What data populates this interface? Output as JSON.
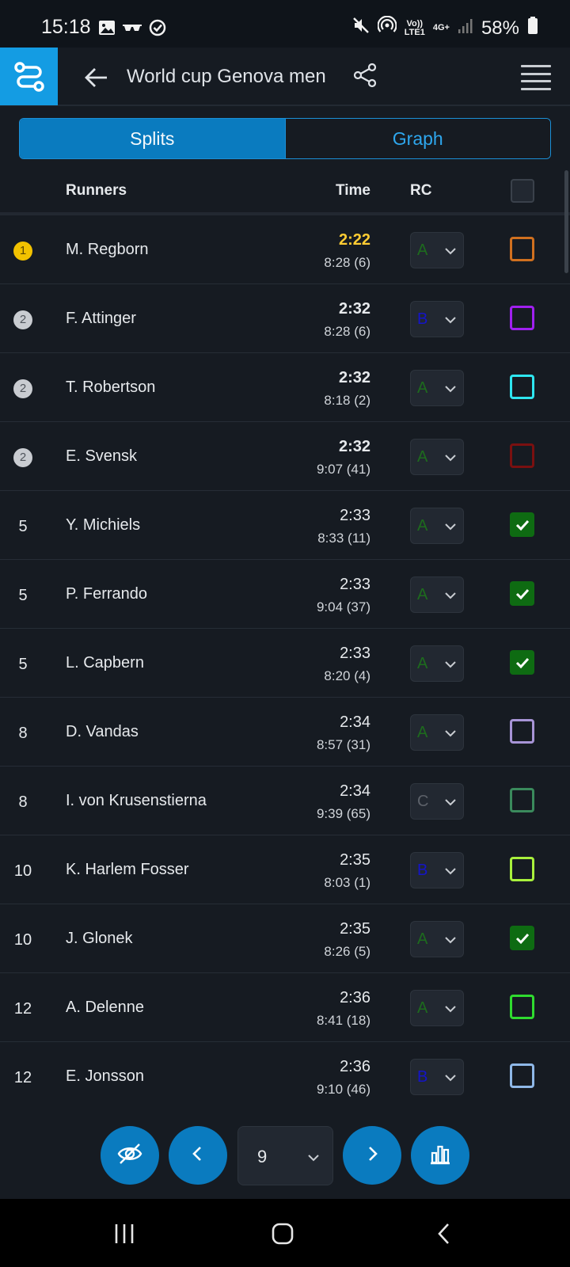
{
  "status_bar": {
    "time": "15:18",
    "battery": "58%",
    "net_top": "Vo))",
    "net_bottom": "LTE1",
    "net_type": "4G+",
    "icons": [
      "image-icon",
      "glasses-icon",
      "check-circle-icon",
      "mute-icon",
      "hotspot-icon",
      "signal-icon",
      "battery-icon"
    ]
  },
  "app_bar": {
    "title": "World cup Genova men",
    "icons": [
      "route-logo-icon",
      "back-arrow-icon",
      "share-icon",
      "menu-icon"
    ],
    "logo_color": "#149ce3"
  },
  "tabs": [
    {
      "label": "Splits",
      "active": true
    },
    {
      "label": "Graph",
      "active": false
    }
  ],
  "list_header": {
    "runners": "Runners",
    "time": "Time",
    "rc": "RC"
  },
  "rows": [
    {
      "rank": "1",
      "medal": "gold",
      "name": "M. Regborn",
      "split": "2:22",
      "split_style": "best",
      "cumulative": "8:28 (6)",
      "rc": "A",
      "rc_color": "#1d6b1d",
      "checkbox": {
        "checked": false,
        "color": "#d0701f"
      }
    },
    {
      "rank": "2",
      "medal": "silver",
      "name": "F. Attinger",
      "split": "2:32",
      "split_style": "bold",
      "cumulative": "8:28 (6)",
      "rc": "B",
      "rc_color": "#1414c8",
      "checkbox": {
        "checked": false,
        "color": "#a020f0"
      }
    },
    {
      "rank": "2",
      "medal": "silver",
      "name": "T. Robertson",
      "split": "2:32",
      "split_style": "bold",
      "cumulative": "8:18 (2)",
      "rc": "A",
      "rc_color": "#1d6b1d",
      "checkbox": {
        "checked": false,
        "color": "#2ee6f0"
      }
    },
    {
      "rank": "2",
      "medal": "silver",
      "name": "E. Svensk",
      "split": "2:32",
      "split_style": "bold",
      "cumulative": "9:07 (41)",
      "rc": "A",
      "rc_color": "#1d6b1d",
      "checkbox": {
        "checked": false,
        "color": "#7a1010"
      }
    },
    {
      "rank": "5",
      "medal": "",
      "name": "Y. Michiels",
      "split": "2:33",
      "split_style": "normal",
      "cumulative": "8:33 (11)",
      "rc": "A",
      "rc_color": "#1d6b1d",
      "checkbox": {
        "checked": true,
        "color": "#0e6b12"
      }
    },
    {
      "rank": "5",
      "medal": "",
      "name": "P. Ferrando",
      "split": "2:33",
      "split_style": "normal",
      "cumulative": "9:04 (37)",
      "rc": "A",
      "rc_color": "#1d6b1d",
      "checkbox": {
        "checked": true,
        "color": "#0e6b12"
      }
    },
    {
      "rank": "5",
      "medal": "",
      "name": "L. Capbern",
      "split": "2:33",
      "split_style": "normal",
      "cumulative": "8:20 (4)",
      "rc": "A",
      "rc_color": "#1d6b1d",
      "checkbox": {
        "checked": true,
        "color": "#0e6b12"
      }
    },
    {
      "rank": "8",
      "medal": "",
      "name": "D. Vandas",
      "split": "2:34",
      "split_style": "normal",
      "cumulative": "8:57 (31)",
      "rc": "A",
      "rc_color": "#1d6b1d",
      "checkbox": {
        "checked": false,
        "color": "#a794d6"
      }
    },
    {
      "rank": "8",
      "medal": "",
      "name": "I. von Krusenstierna",
      "split": "2:34",
      "split_style": "normal",
      "cumulative": "9:39 (65)",
      "rc": "C",
      "rc_color": "#5c6169",
      "checkbox": {
        "checked": false,
        "color": "#3a8a5c"
      }
    },
    {
      "rank": "10",
      "medal": "",
      "name": "K. Harlem Fosser",
      "split": "2:35",
      "split_style": "normal",
      "cumulative": "8:03 (1)",
      "rc": "B",
      "rc_color": "#1414c8",
      "checkbox": {
        "checked": false,
        "color": "#a8f03c"
      }
    },
    {
      "rank": "10",
      "medal": "",
      "name": "J. Glonek",
      "split": "2:35",
      "split_style": "normal",
      "cumulative": "8:26 (5)",
      "rc": "A",
      "rc_color": "#1d6b1d",
      "checkbox": {
        "checked": true,
        "color": "#0e6b12"
      }
    },
    {
      "rank": "12",
      "medal": "",
      "name": "A. Delenne",
      "split": "2:36",
      "split_style": "normal",
      "cumulative": "8:41 (18)",
      "rc": "A",
      "rc_color": "#1d6b1d",
      "checkbox": {
        "checked": false,
        "color": "#2fdb2f"
      }
    },
    {
      "rank": "12",
      "medal": "",
      "name": "E. Jonsson",
      "split": "2:36",
      "split_style": "normal",
      "cumulative": "9:10 (46)",
      "rc": "B",
      "rc_color": "#1414c8",
      "checkbox": {
        "checked": false,
        "color": "#8fb8e8"
      }
    }
  ],
  "controls": {
    "page_value": "9",
    "buttons": [
      "eye-off-icon",
      "chevron-left-icon",
      "chevron-right-icon",
      "bar-chart-icon"
    ],
    "accent": "#0a7bbf"
  },
  "nav_bar": {
    "icons": [
      "recents-icon",
      "home-icon",
      "back-icon"
    ]
  }
}
